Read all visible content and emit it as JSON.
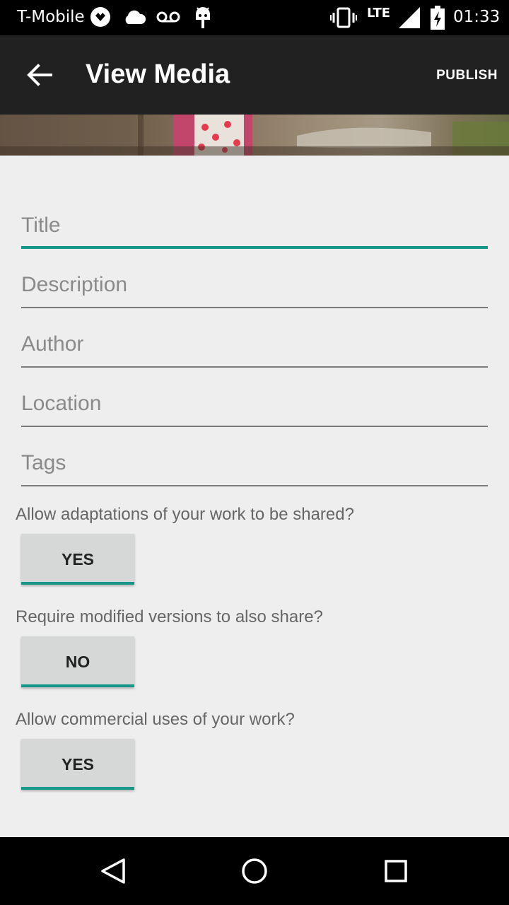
{
  "status_bar": {
    "carrier": "T-Mobile",
    "network": "LTE",
    "time": "01:33",
    "icons": [
      "mobile-data-icon",
      "cloud-icon",
      "voicemail-icon",
      "android-icon",
      "vibrate-icon",
      "signal-icon",
      "battery-charging-icon"
    ]
  },
  "app_bar": {
    "title": "View Media",
    "publish_label": "PUBLISH"
  },
  "form": {
    "title_placeholder": "Title",
    "description_placeholder": "Description",
    "author_placeholder": "Author",
    "location_placeholder": "Location",
    "tags_placeholder": "Tags"
  },
  "license": {
    "q1": "Allow adaptations of your work to be shared?",
    "a1": "YES",
    "q2": "Require modified versions to also share?",
    "a2": "NO",
    "q3": "Allow commercial uses of your work?",
    "a3": "YES"
  },
  "colors": {
    "accent": "#17968a",
    "app_bar": "#212121",
    "background": "#eeeeee"
  }
}
